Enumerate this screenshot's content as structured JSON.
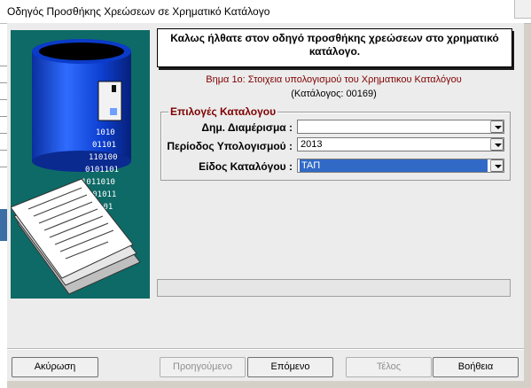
{
  "window": {
    "title": "Οδηγός Προσθήκης Χρεώσεων σε Χρηματικό Κατάλογο"
  },
  "header": {
    "welcome": "Καλως ήλθατε στον οδηγό προσθήκης χρεώσεων στο χρηματικό κατάλογο."
  },
  "step": {
    "text": "Βημα 1ο: Στοιχεια υπολογισμού του Χρηματικου Καταλόγου",
    "catalog": "(Κατάλογος: 00169)"
  },
  "group": {
    "title": "Επιλογές Καταλογου",
    "fields": [
      {
        "label": "Δημ. Διαμέρισμα :",
        "value": ""
      },
      {
        "label": "Περίοδος Υπολογισμού :",
        "value": "2013"
      },
      {
        "label": "Είδος Καταλόγου :",
        "value": "ΤΑΠ"
      }
    ]
  },
  "buttons": {
    "cancel": "Ακύρωση",
    "previous": "Προηγούμενο",
    "next": "Επόμενο",
    "finish": "Τέλος",
    "help": "Βοήθεια"
  },
  "colors": {
    "art_bg": "#0e6a66",
    "accent": "#800000",
    "selection": "#3169c6"
  }
}
